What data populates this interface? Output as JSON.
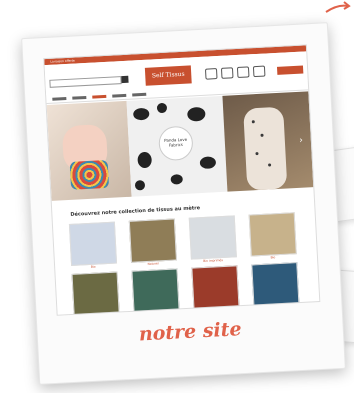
{
  "caption": "notre site",
  "website": {
    "topstrip_text": "Livraison offerte",
    "logo_text": "Self Tissus",
    "hero_logo_text": "Panda Love Fabrics",
    "section_title": "Découvrez notre collection de tissus au mètre",
    "tiles": [
      {
        "label": "Bio",
        "color": "#cfd8e6"
      },
      {
        "label": "Naturel",
        "color": "#8f7d57"
      },
      {
        "label": "Bio imprimés",
        "color": "#d9dde1"
      },
      {
        "label": "Bio",
        "color": "#c7b28b"
      },
      {
        "label": "",
        "color": "#6b6a43"
      },
      {
        "label": "",
        "color": "#3f6a5a"
      },
      {
        "label": "",
        "color": "#9b3b2a"
      },
      {
        "label": "",
        "color": "#2e5a7a"
      }
    ]
  },
  "colors": {
    "accent": "#e0624a",
    "brand": "#c8502f"
  }
}
